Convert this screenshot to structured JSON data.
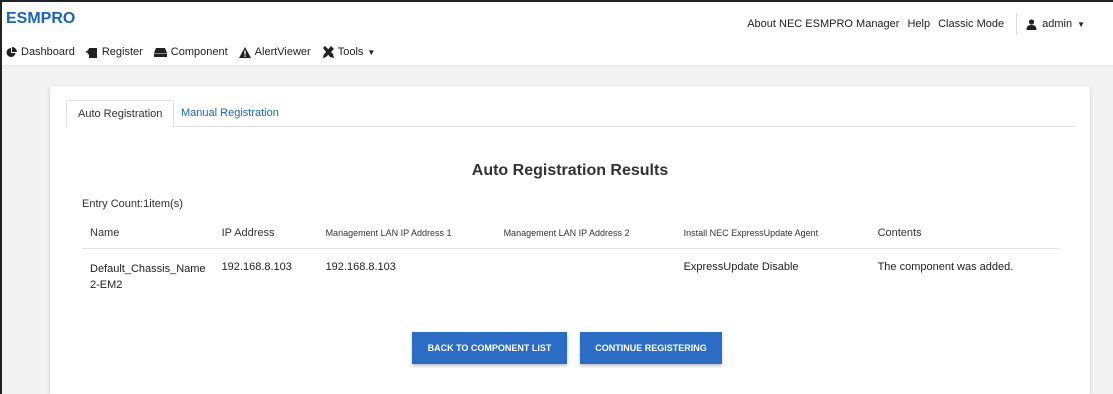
{
  "header": {
    "brand": "ESMPRO",
    "links": [
      "About NEC ESMPRO Manager",
      "Help",
      "Classic Mode"
    ],
    "user": "admin"
  },
  "menu": [
    {
      "label": "Dashboard",
      "icon": "pie-chart-icon"
    },
    {
      "label": "Register",
      "icon": "register-icon"
    },
    {
      "label": "Component",
      "icon": "server-icon"
    },
    {
      "label": "AlertViewer",
      "icon": "warning-icon"
    },
    {
      "label": "Tools",
      "icon": "tools-icon"
    }
  ],
  "tabs": [
    "Auto Registration",
    "Manual Registration"
  ],
  "main": {
    "title": "Auto Registration Results",
    "entry_count": "Entry Count:1item(s)"
  },
  "table": {
    "headers": [
      "Name",
      "IP Address",
      "Management LAN IP Address 1",
      "Management LAN IP Address 2",
      "Install NEC ExpressUpdate Agent",
      "Contents"
    ],
    "rows": [
      {
        "name": "Default_Chassis_Name 2-EM2",
        "ip": "192.168.8.103",
        "mgmt1": "192.168.8.103",
        "mgmt2": "",
        "install": "ExpressUpdate Disable",
        "contents": "The component was added."
      }
    ]
  },
  "buttons": {
    "back": "BACK TO COMPONENT LIST",
    "continue": "CONTINUE REGISTERING"
  },
  "colors": {
    "accent": "#1565c0",
    "button": "#2b6cc4",
    "page_background": "#f2f2f2"
  }
}
